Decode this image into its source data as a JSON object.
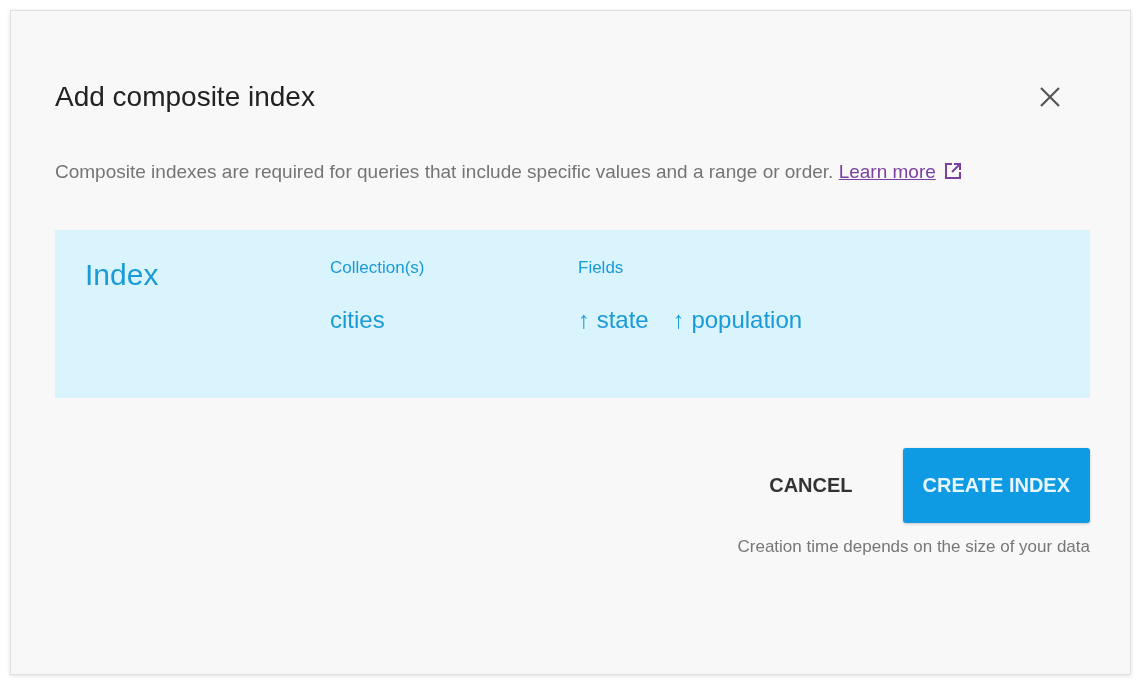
{
  "dialog": {
    "title": "Add composite index",
    "description": "Composite indexes are required for queries that include specific values and a range or order.",
    "link": "Learn more"
  },
  "index": {
    "heading": "Index",
    "collection_label": "Collection(s)",
    "collection": "cities",
    "fields_label": "Fields",
    "fields": [
      {
        "arrow": "↑",
        "name": "state"
      },
      {
        "arrow": "↑",
        "name": "population"
      }
    ]
  },
  "buttons": [
    {
      "label": "CANCEL",
      "kind": "text"
    },
    {
      "label": "CREATE INDEX",
      "kind": "primary"
    }
  ],
  "note": "Creation time depends on the size of your data"
}
